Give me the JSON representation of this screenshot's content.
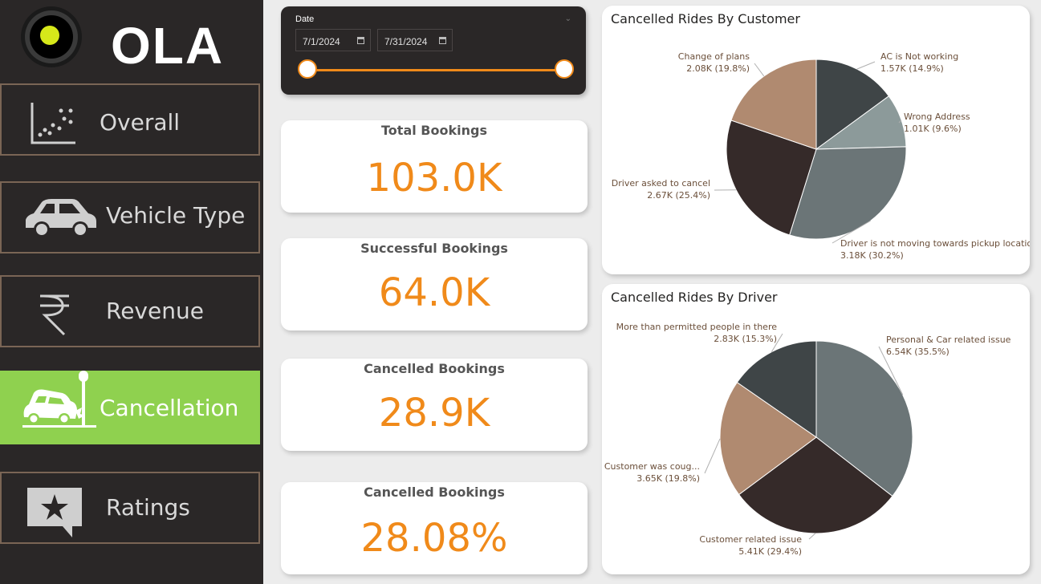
{
  "brand": {
    "name": "OLA"
  },
  "nav": [
    {
      "label": "Overall",
      "icon": "scatter-plot-icon",
      "active": false
    },
    {
      "label": "Vehicle Type",
      "icon": "car-icon",
      "active": false
    },
    {
      "label": "Revenue",
      "icon": "rupee-icon",
      "active": false
    },
    {
      "label": "Cancellation",
      "icon": "car-crash-icon",
      "active": true
    },
    {
      "label": "Ratings",
      "icon": "star-chat-icon",
      "active": false
    }
  ],
  "date_filter": {
    "title": "Date",
    "start": "7/1/2024",
    "end": "7/31/2024",
    "accent": "#f08a1a"
  },
  "kpis": [
    {
      "title": "Total Bookings",
      "value": "103.0K"
    },
    {
      "title": "Successful Bookings",
      "value": "64.0K"
    },
    {
      "title": "Cancelled Bookings",
      "value": "28.9K"
    },
    {
      "title": "Cancelled Bookings",
      "value": "28.08%"
    }
  ],
  "colors": {
    "sidebar_bg": "#2a2727",
    "active_nav": "#8fd14f",
    "nav_border": "#7a6555",
    "kpi_value": "#f08a1a"
  },
  "chart_data": [
    {
      "type": "pie",
      "title": "Cancelled Rides By Customer",
      "slices": [
        {
          "label": "AC is Not working",
          "value": 1.57,
          "display": "1.57K (14.9%)",
          "percent": 14.9,
          "color": "#3f4547"
        },
        {
          "label": "Wrong Address",
          "value": 1.01,
          "display": "1.01K (9.6%)",
          "percent": 9.6,
          "color": "#8c9a9a"
        },
        {
          "label": "Driver is not moving towards pickup location",
          "value": 3.18,
          "display": "3.18K (30.2%)",
          "percent": 30.2,
          "color": "#6b7577"
        },
        {
          "label": "Driver asked to cancel",
          "value": 2.67,
          "display": "2.67K (25.4%)",
          "percent": 25.4,
          "color": "#352a29"
        },
        {
          "label": "Change of plans",
          "value": 2.08,
          "display": "2.08K (19.8%)",
          "percent": 19.8,
          "color": "#b08a70"
        }
      ]
    },
    {
      "type": "pie",
      "title": "Cancelled Rides By Driver",
      "slices": [
        {
          "label": "Personal & Car related issue",
          "value": 6.54,
          "display": "6.54K (35.5%)",
          "percent": 35.5,
          "color": "#6b7577"
        },
        {
          "label": "Customer related issue",
          "value": 5.41,
          "display": "5.41K (29.4%)",
          "percent": 29.4,
          "color": "#352a29"
        },
        {
          "label": "Customer was coug...",
          "value": 3.65,
          "display": "3.65K (19.8%)",
          "percent": 19.8,
          "color": "#b08a70"
        },
        {
          "label": "More than permitted people in there",
          "value": 2.83,
          "display": "2.83K (15.3%)",
          "percent": 15.3,
          "color": "#3f4547"
        }
      ]
    }
  ]
}
